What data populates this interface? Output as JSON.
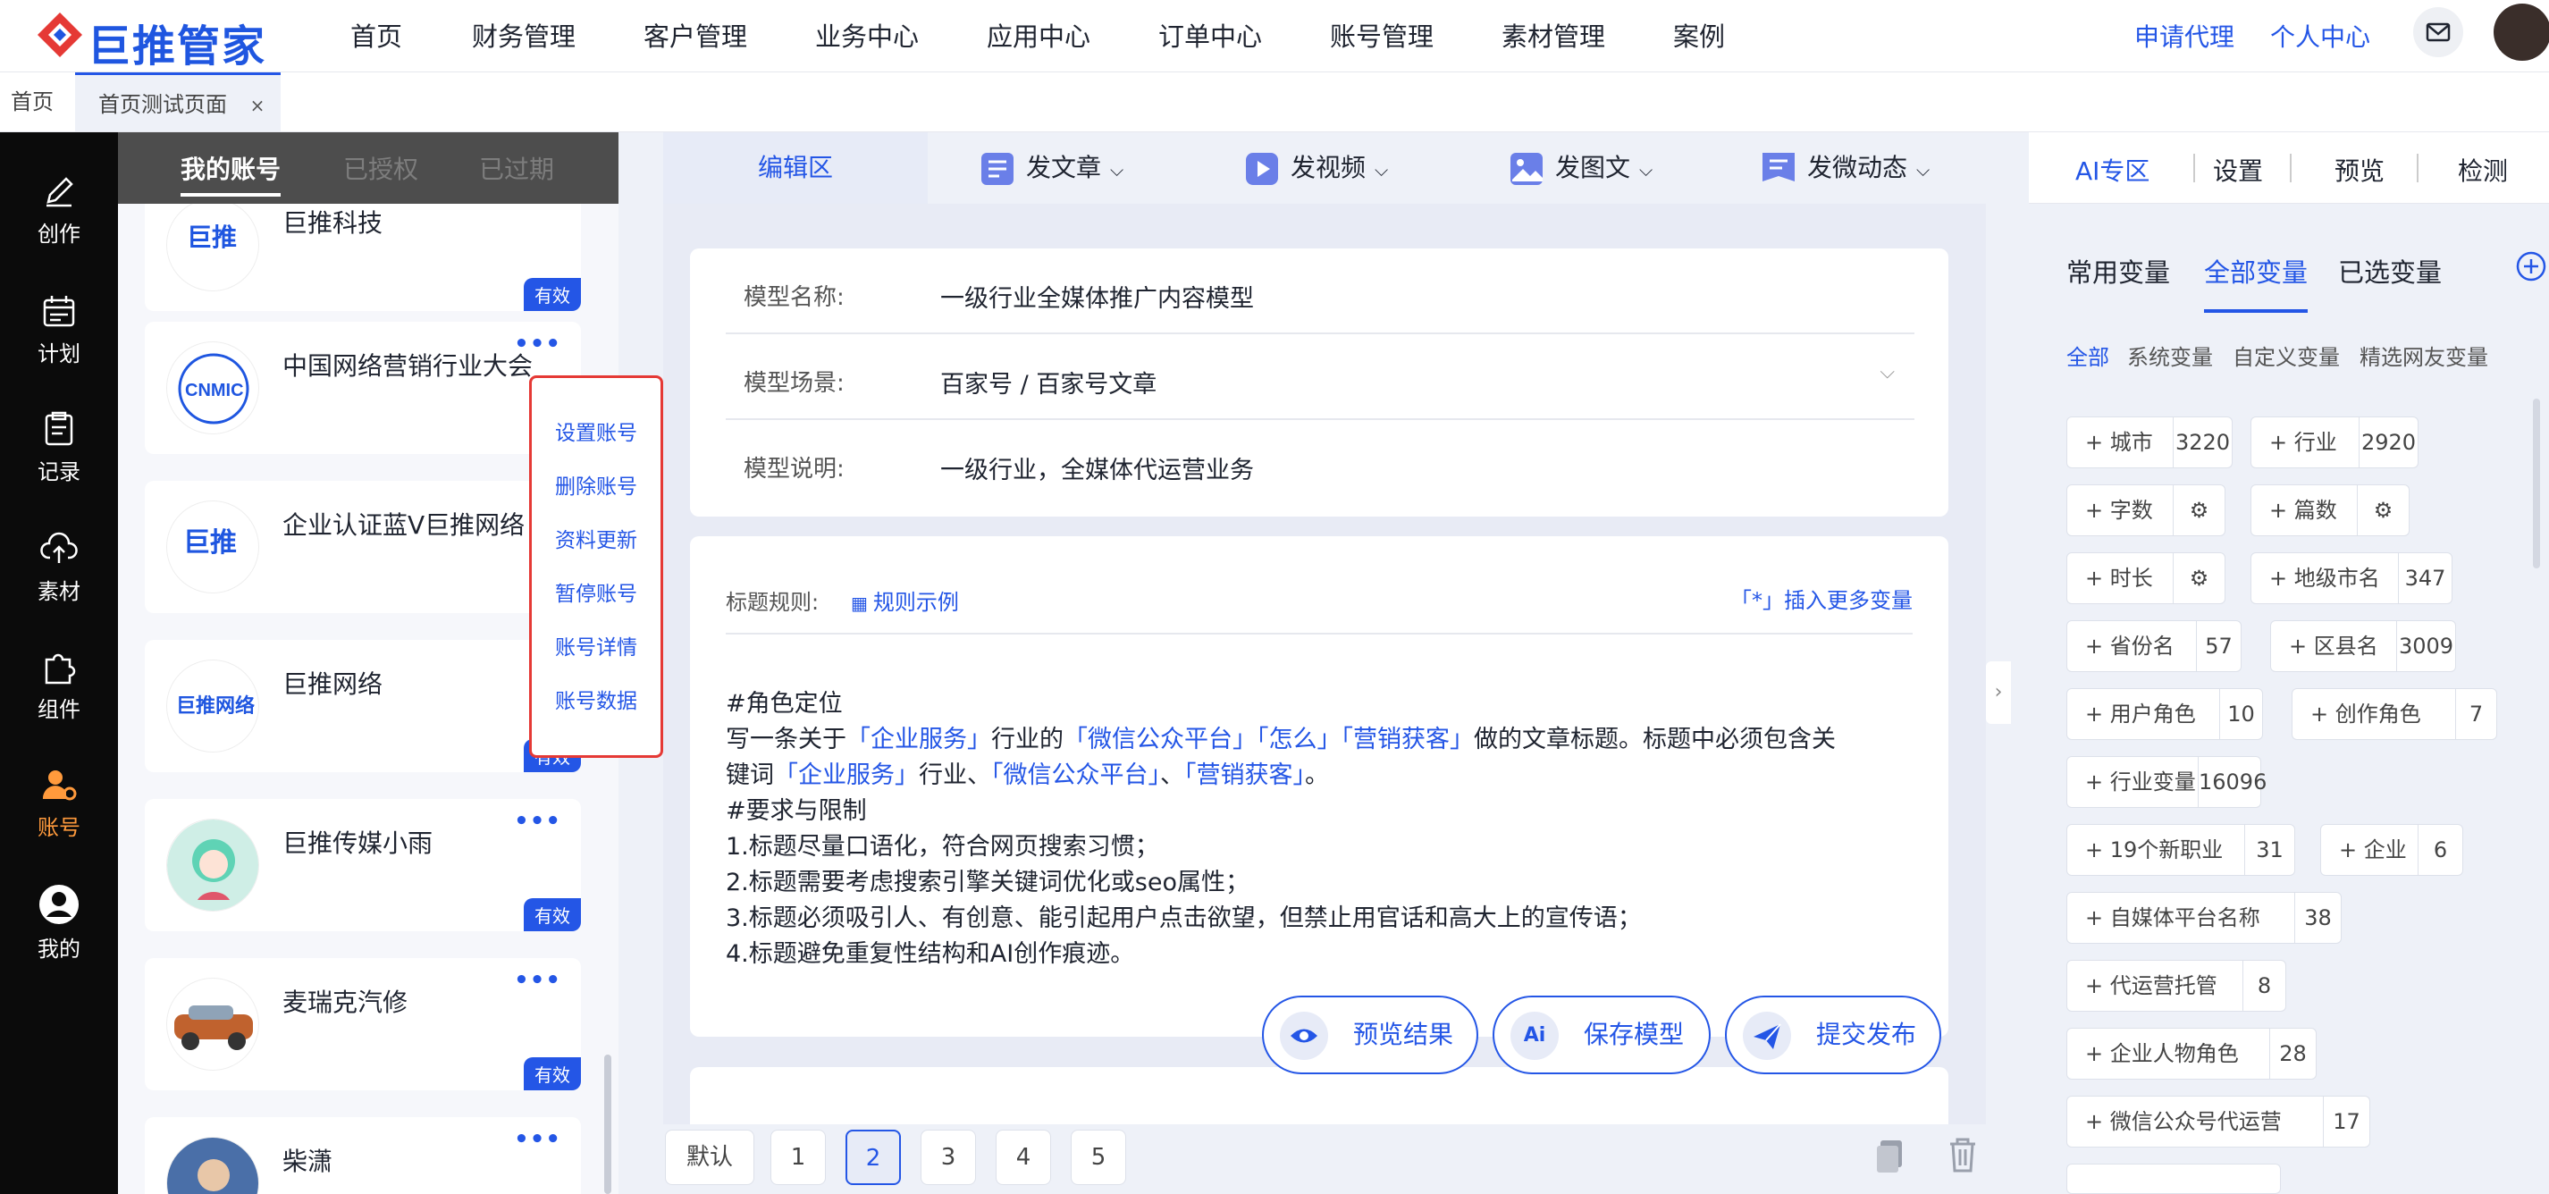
{
  "brand": {
    "name": "巨推管家"
  },
  "nav": {
    "items": [
      "首页",
      "财务管理",
      "客户管理",
      "业务中心",
      "应用中心",
      "订单中心",
      "账号管理",
      "素材管理",
      "案例"
    ],
    "apply_agent": "申请代理",
    "personal_center": "个人中心"
  },
  "tabs": {
    "home": "首页",
    "active": "首页测试页面",
    "close": "×"
  },
  "rail": {
    "items": [
      "创作",
      "计划",
      "记录",
      "素材",
      "组件",
      "账号",
      "我的"
    ]
  },
  "accounts": {
    "tabs": [
      "我的账号",
      "已授权",
      "已过期"
    ],
    "cards": [
      {
        "name": "巨推科技",
        "badge": "有效"
      },
      {
        "name": "中国网络营销行业大会",
        "more": "•••"
      },
      {
        "name": "企业认证蓝V巨推网络"
      },
      {
        "name": "巨推网络",
        "badge": "有效"
      },
      {
        "name": "巨推传媒小雨",
        "more": "•••",
        "badge": "有效"
      },
      {
        "name": "麦瑞克汽修",
        "more": "•••",
        "badge": "有效"
      },
      {
        "name": "柴潇",
        "more": "•••"
      }
    ],
    "menu": [
      "设置账号",
      "删除账号",
      "资料更新",
      "暂停账号",
      "账号详情",
      "账号数据"
    ]
  },
  "editor": {
    "tabs": {
      "edit": "编辑区",
      "article": "发文章",
      "video": "发视频",
      "image_text": "发图文",
      "micro": "发微动态"
    },
    "model": {
      "name_label": "模型名称:",
      "name_value": "一级行业全媒体推广内容模型",
      "scene_label": "模型场景:",
      "scene_value": "百家号 / 百家号文章",
      "desc_label": "模型说明:",
      "desc_value": "一级行业，全媒体代运营业务"
    },
    "rule": {
      "label": "标题规则:",
      "example": "规则示例",
      "insert": "「*」插入更多变量",
      "l1": "#角色定位",
      "l2a": "写一条关于",
      "l2b": "「企业服务」",
      "l2c": "行业的",
      "l2d": "「微信公众平台」「怎么」「营销获客」",
      "l2e": "做的文章标题。标题中必须包含关",
      "l3a": "键词",
      "l3b": "「企业服务」",
      "l3c": "行业、",
      "l3d": "「微信公众平台」",
      "l3e": "、",
      "l3f": "「营销获客」",
      "l3g": "。",
      "l4": "#要求与限制",
      "l5": "1.标题尽量口语化，符合网页搜索习惯；",
      "l6": "2.标题需要考虑搜索引擎关键词优化或seo属性；",
      "l7": "3.标题必须吸引人、有创意、能引起用户点击欲望，但禁止用官话和高大上的宣传语；",
      "l8": "4.标题避免重复性结构和AI创作痕迹。"
    },
    "actions": {
      "preview": "预览结果",
      "save": "保存模型",
      "submit": "提交发布",
      "ai_badge": "Ai"
    },
    "pager": {
      "default": "默认",
      "pages": [
        "1",
        "2",
        "3",
        "4",
        "5"
      ],
      "current": "2"
    }
  },
  "right": {
    "tabs": [
      "AI专区",
      "设置",
      "预览",
      "检测"
    ],
    "var_tabs": [
      "常用变量",
      "全部变量",
      "已选变量"
    ],
    "filters": [
      "全部",
      "系统变量",
      "自定义变量",
      "精选网友变量"
    ],
    "chips": [
      {
        "label": "+ 城市",
        "count": "3220"
      },
      {
        "label": "+ 行业",
        "count": "2920"
      },
      {
        "label": "+ 字数",
        "icon": "gear-icon"
      },
      {
        "label": "+ 篇数",
        "icon": "gear-icon"
      },
      {
        "label": "+ 时长",
        "icon": "gear-icon"
      },
      {
        "label": "+ 地级市名",
        "count": "347"
      },
      {
        "label": "+ 省份名",
        "count": "57"
      },
      {
        "label": "+ 区县名",
        "count": "3009"
      },
      {
        "label": "+ 用户角色",
        "count": "10"
      },
      {
        "label": "+ 创作角色",
        "count": "7"
      },
      {
        "label": "+ 行业变量",
        "count": "16096"
      },
      {
        "label": "+ 19个新职业",
        "count": "31"
      },
      {
        "label": "+ 企业",
        "count": "6"
      },
      {
        "label": "+ 自媒体平台名称",
        "count": "38"
      },
      {
        "label": "+ 代运营托管",
        "count": "8"
      },
      {
        "label": "+ 企业人物角色",
        "count": "28"
      },
      {
        "label": "+ 微信公众号代运营",
        "count": "17"
      }
    ]
  },
  "colors": {
    "accent": "#2456e6",
    "rail": "#0b0b0b",
    "rail_active": "#ff9a3c",
    "menu_border": "#e53935"
  }
}
